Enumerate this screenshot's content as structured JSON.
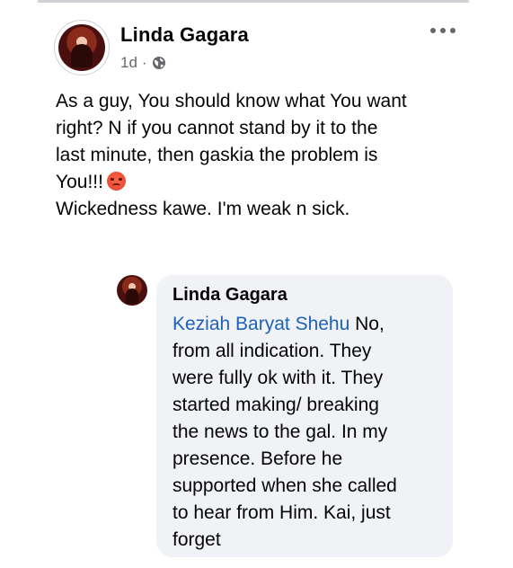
{
  "post": {
    "author": "Linda Gagara",
    "time": "1d",
    "separator": "·",
    "privacy_icon": "globe-icon",
    "more_icon": "more-horizontal-icon",
    "text_lines": [
      "As a guy, You should know what You want",
      "right? N if you cannot stand by it to the",
      "last minute, then gaskia the problem is",
      "You!!!",
      "Wickedness kawe. I'm weak n sick."
    ],
    "emoji": "angry-face"
  },
  "comment": {
    "author": "Linda Gagara",
    "mention": "Keziah Baryat Shehu",
    "first_line_rest": " No,",
    "text_lines": [
      "from all indication. They",
      "were fully ok with it. They",
      "started making/ breaking",
      "the news to the gal. In my",
      "presence. Before he",
      "supported when she called",
      "to hear from Him. Kai, just",
      "forget"
    ]
  },
  "colors": {
    "name": "#050505",
    "meta": "#65676b",
    "mention": "#1d62b8",
    "bubble": "#f0f2f5"
  }
}
